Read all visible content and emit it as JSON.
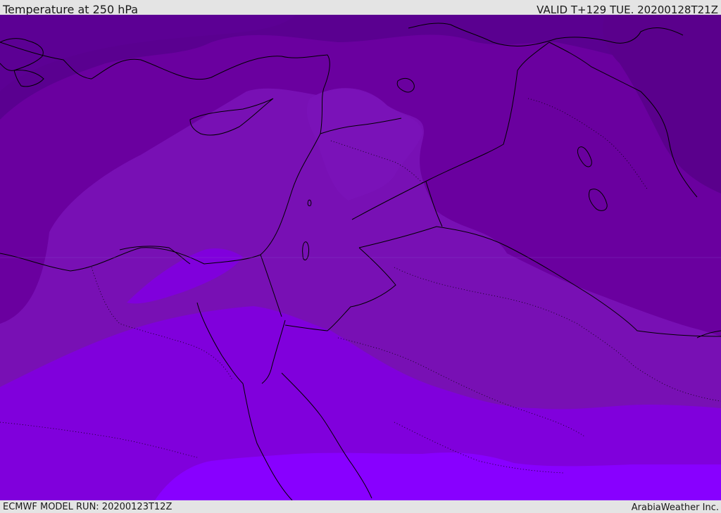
{
  "header": {
    "title": "Temperature at 250 hPa",
    "valid": "VALID T+129 TUE. 20200128T21Z"
  },
  "footer": {
    "model_run": "ECMWF MODEL RUN: 20200123T12Z",
    "credit": "ArabiaWeather Inc."
  },
  "map": {
    "region": "Eastern Mediterranean / Middle East",
    "colors": {
      "band_coldest": "#5a0090",
      "band_cold": "#6a009f",
      "band_mid": "#7810b4",
      "band_warm": "#8000dc",
      "band_warmest": "#8800ff",
      "coastline": "#000000",
      "border": "#000000"
    }
  }
}
